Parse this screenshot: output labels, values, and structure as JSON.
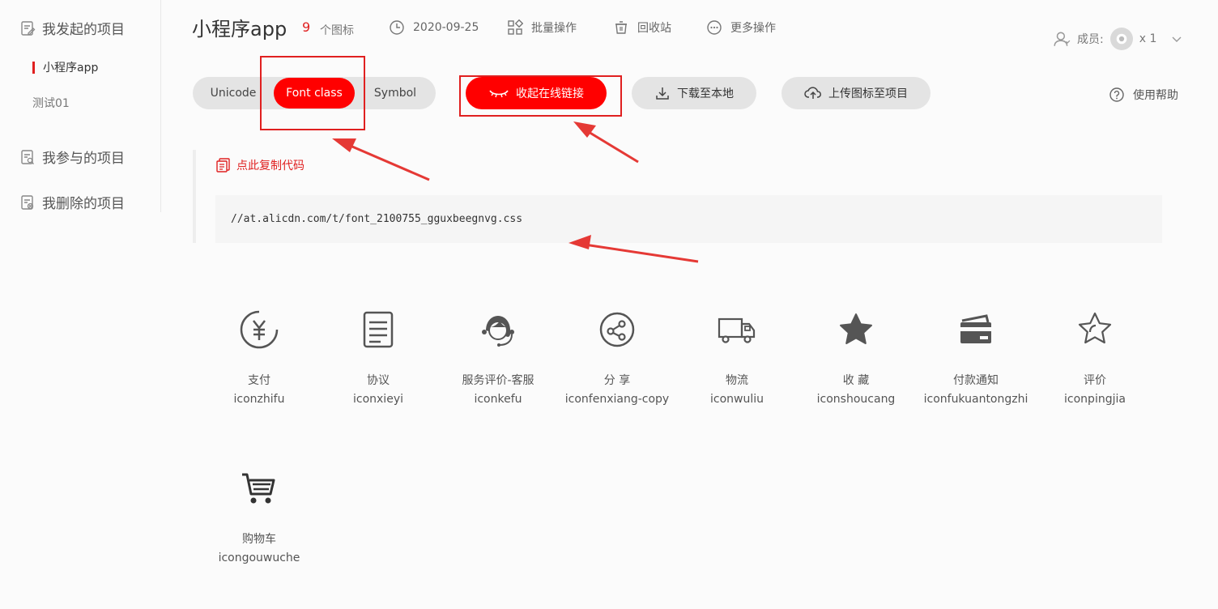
{
  "sidebar": {
    "groups": [
      {
        "label": "我发起的项目",
        "subs": [
          {
            "label": "小程序app",
            "active": true
          },
          {
            "label": "测试01",
            "active": false
          }
        ]
      },
      {
        "label": "我参与的项目"
      },
      {
        "label": "我删除的项目"
      }
    ]
  },
  "header": {
    "title": "小程序app",
    "icon_count": "9",
    "icon_count_label": "个图标",
    "date": "2020-09-25",
    "batch": "批量操作",
    "recycle": "回收站",
    "more": "更多操作",
    "members_label": "成员:",
    "members_count": "x 1"
  },
  "tabs": [
    {
      "label": "Unicode",
      "active": false
    },
    {
      "label": "Font class",
      "active": true
    },
    {
      "label": "Symbol",
      "active": false
    }
  ],
  "actions": {
    "collapse_link": "收起在线链接",
    "download": "下载至本地",
    "upload": "上传图标至项目",
    "help": "使用帮助"
  },
  "code": {
    "copy_label": "点此复制代码",
    "url": "//at.alicdn.com/t/font_2100755_gguxbeegnvg.css"
  },
  "icons": [
    {
      "name": "支付",
      "class": "iconzhifu",
      "icon": "yuan-circle-icon"
    },
    {
      "name": "协议",
      "class": "iconxieyi",
      "icon": "document-icon"
    },
    {
      "name": "服务评价-客服",
      "class": "iconkefu",
      "icon": "customer-service-icon"
    },
    {
      "name": "分 享",
      "class": "iconfenxiang-copy",
      "icon": "share-icon"
    },
    {
      "name": "物流",
      "class": "iconwuliu",
      "icon": "truck-icon"
    },
    {
      "name": "收 藏",
      "class": "iconshoucang",
      "icon": "star-filled-icon"
    },
    {
      "name": "付款通知",
      "class": "iconfukuantongzhi",
      "icon": "card-icon"
    },
    {
      "name": "评价",
      "class": "iconpingjia",
      "icon": "star-outline-icon"
    },
    {
      "name": "购物车",
      "class": "icongouwuche",
      "icon": "cart-icon"
    }
  ],
  "colors": {
    "accent": "#ff0000",
    "annotation": "#e02020"
  }
}
